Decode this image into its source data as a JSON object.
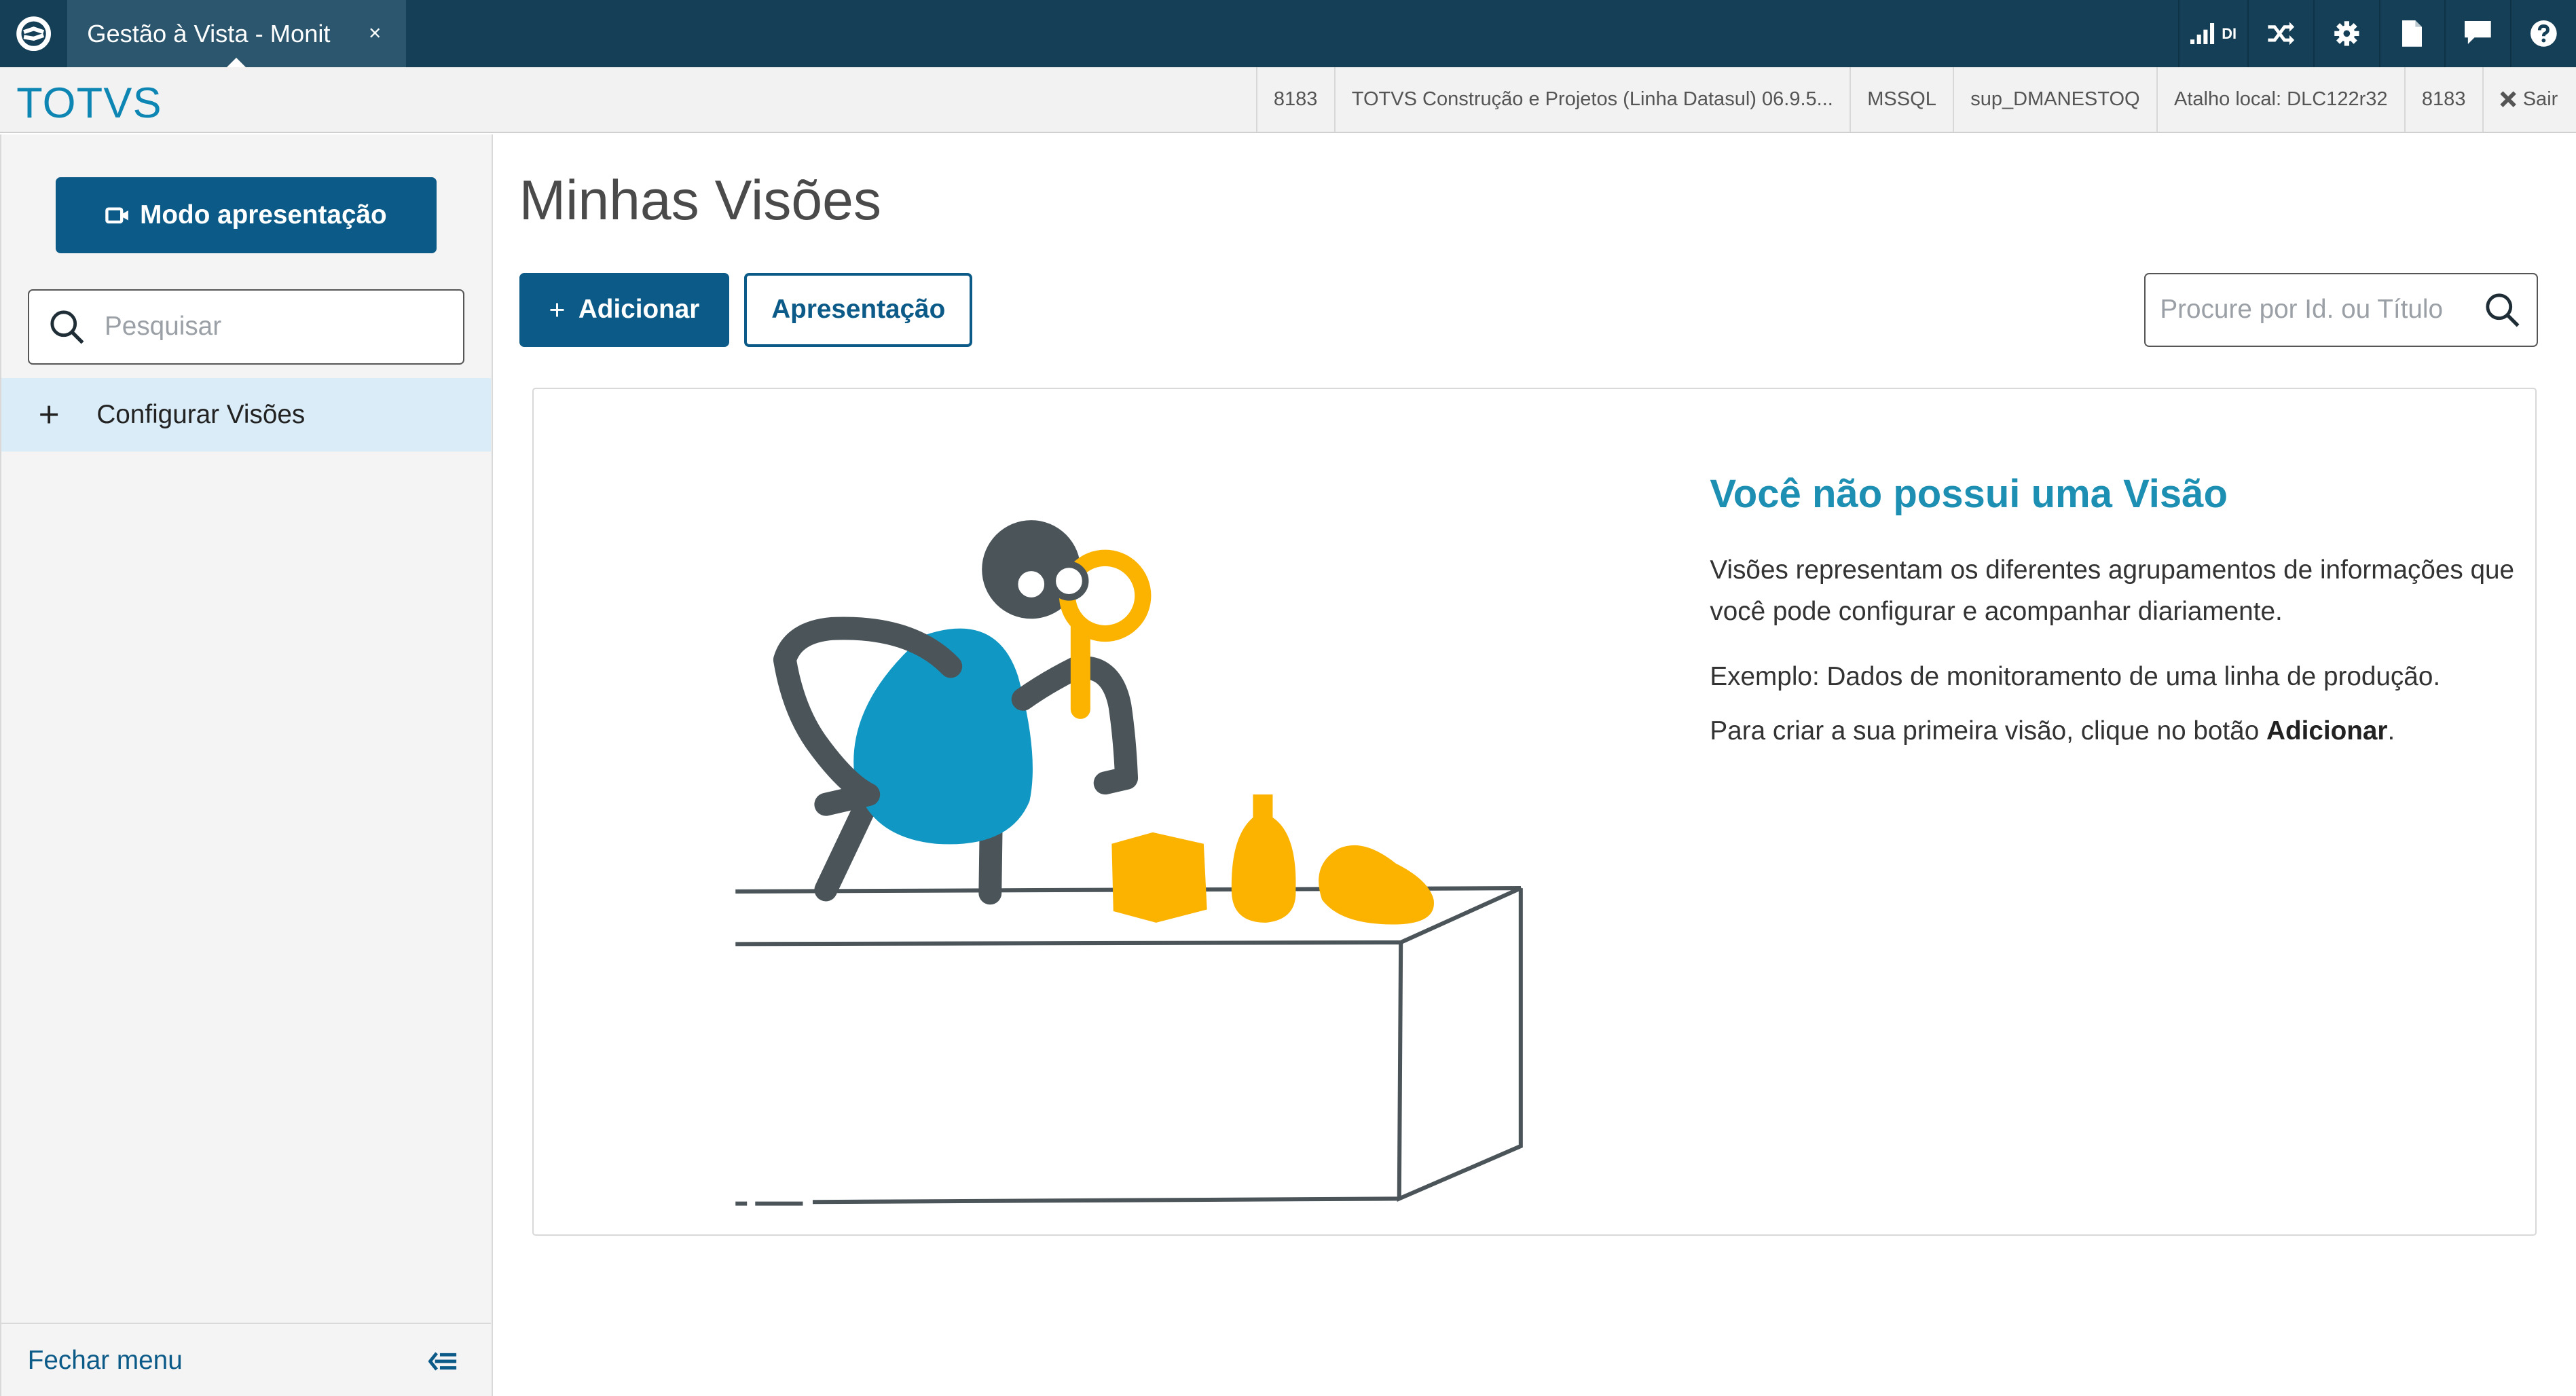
{
  "topbar": {
    "tab_title": "Gestão à Vista - Monit",
    "close_symbol": "×",
    "signal_text": "DI",
    "icons": [
      "totvs-logo-icon",
      "signal-icon",
      "shuffle-icon",
      "gear-icon",
      "document-icon",
      "chat-icon",
      "help-icon"
    ]
  },
  "infobar": {
    "brand": "TOTVS",
    "items": [
      "8183",
      "TOTVS Construção e Projetos (Linha Datasul) 06.9.5...",
      "MSSQL",
      "sup_DMANESTOQ",
      "Atalho local: DLC122r32",
      "8183"
    ],
    "exit_label": "Sair"
  },
  "sidebar": {
    "presentation_button": "Modo apresentação",
    "search_placeholder": "Pesquisar",
    "menu_item": "Configurar Visões",
    "close_menu": "Fechar menu"
  },
  "main": {
    "title": "Minhas Visões",
    "add_button": "Adicionar",
    "presentation_button": "Apresentação",
    "search_placeholder": "Procure por Id. ou Título",
    "empty": {
      "title": "Você não possui uma Visão",
      "text1": "Visões representam os diferentes agrupamentos de informações que você pode configurar e acompanhar diariamente.",
      "text2": "Exemplo: Dados de monitoramento de uma linha de produção.",
      "text3_prefix": "Para criar a sua primeira visão, clique no botão ",
      "text3_bold": "Adicionar",
      "text3_suffix": "."
    }
  },
  "colors": {
    "topbar": "#153f56",
    "primary": "#0b5a87",
    "brand": "#0e86b4",
    "empty_title": "#1d8fb3",
    "illustration_blue": "#1197c3",
    "illustration_yellow": "#fbb300",
    "illustration_dark": "#4a5459"
  }
}
